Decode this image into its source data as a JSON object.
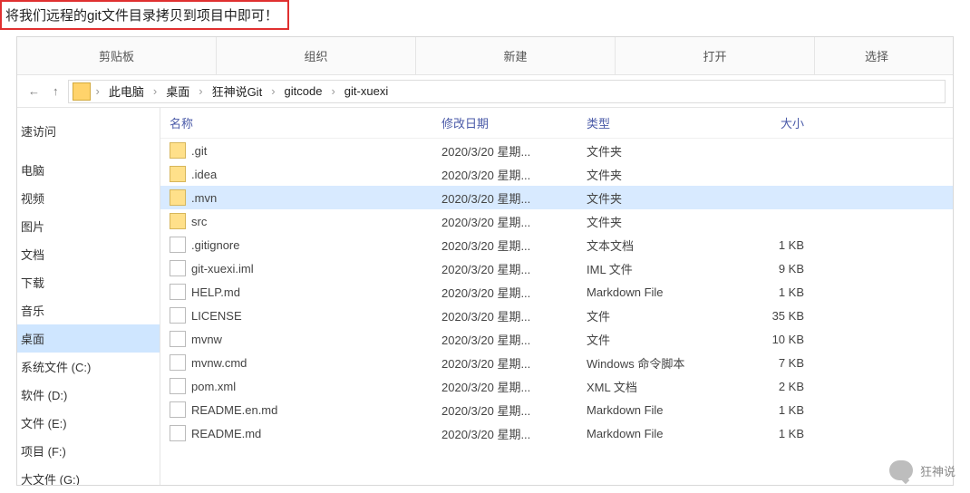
{
  "caption": "将我们远程的git文件目录拷贝到项目中即可！",
  "ribbon": [
    "剪贴板",
    "组织",
    "新建",
    "打开",
    "选择"
  ],
  "nav": {
    "back": "←",
    "up": "↑",
    "crumbs": [
      "此电脑",
      "桌面",
      "狂神说Git",
      "gitcode",
      "git-xuexi"
    ]
  },
  "tree": [
    "速访问",
    "",
    "电脑",
    "视频",
    "图片",
    "文档",
    "下载",
    "音乐",
    "桌面",
    "系统文件 (C:)",
    "软件 (D:)",
    "文件 (E:)",
    "项目 (F:)",
    "大文件 (G:)"
  ],
  "tree_selected_index": 8,
  "columns": {
    "name": "名称",
    "date": "修改日期",
    "type": "类型",
    "size": "大小"
  },
  "files": [
    {
      "icon": "folder",
      "name": ".git",
      "date": "2020/3/20 星期...",
      "type": "文件夹",
      "size": ""
    },
    {
      "icon": "folder",
      "name": ".idea",
      "date": "2020/3/20 星期...",
      "type": "文件夹",
      "size": ""
    },
    {
      "icon": "folder",
      "name": ".mvn",
      "date": "2020/3/20 星期...",
      "type": "文件夹",
      "size": "",
      "selected": true
    },
    {
      "icon": "folder",
      "name": "src",
      "date": "2020/3/20 星期...",
      "type": "文件夹",
      "size": ""
    },
    {
      "icon": "file",
      "name": ".gitignore",
      "date": "2020/3/20 星期...",
      "type": "文本文档",
      "size": "1 KB"
    },
    {
      "icon": "file",
      "name": "git-xuexi.iml",
      "date": "2020/3/20 星期...",
      "type": "IML 文件",
      "size": "9 KB"
    },
    {
      "icon": "file",
      "name": "HELP.md",
      "date": "2020/3/20 星期...",
      "type": "Markdown File",
      "size": "1 KB"
    },
    {
      "icon": "file",
      "name": "LICENSE",
      "date": "2020/3/20 星期...",
      "type": "文件",
      "size": "35 KB"
    },
    {
      "icon": "file",
      "name": "mvnw",
      "date": "2020/3/20 星期...",
      "type": "文件",
      "size": "10 KB"
    },
    {
      "icon": "file",
      "name": "mvnw.cmd",
      "date": "2020/3/20 星期...",
      "type": "Windows 命令脚本",
      "size": "7 KB"
    },
    {
      "icon": "file",
      "name": "pom.xml",
      "date": "2020/3/20 星期...",
      "type": "XML 文档",
      "size": "2 KB"
    },
    {
      "icon": "file",
      "name": "README.en.md",
      "date": "2020/3/20 星期...",
      "type": "Markdown File",
      "size": "1 KB"
    },
    {
      "icon": "file",
      "name": "README.md",
      "date": "2020/3/20 星期...",
      "type": "Markdown File",
      "size": "1 KB"
    }
  ],
  "watermark": "狂神说"
}
